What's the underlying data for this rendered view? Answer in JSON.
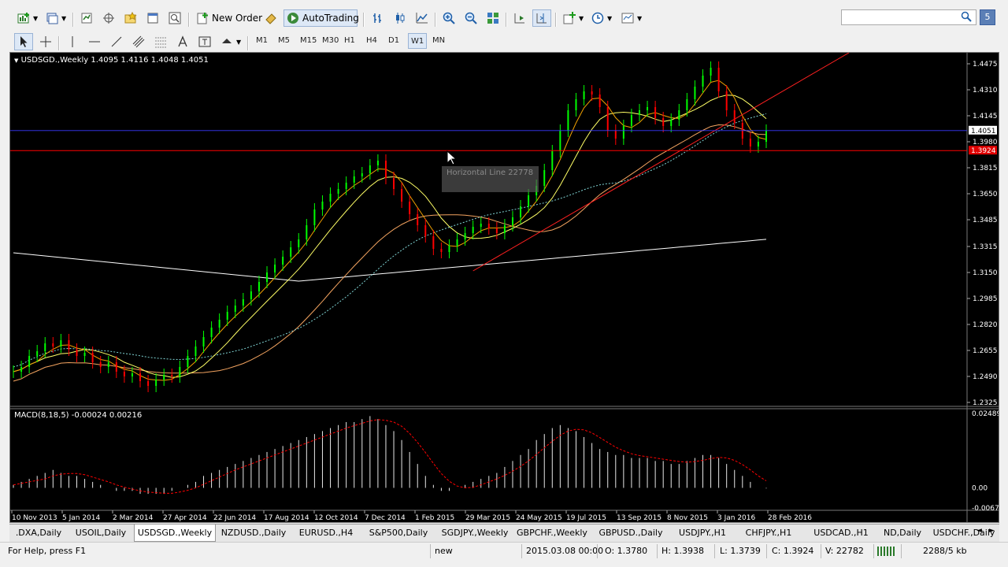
{
  "toolbar1": {
    "new_order_label": "New Order",
    "autotrading_label": "AutoTrading",
    "search_placeholder": ""
  },
  "timeframes": [
    "M1",
    "M5",
    "M15",
    "M30",
    "H1",
    "H4",
    "D1",
    "W1",
    "MN"
  ],
  "active_timeframe": "W1",
  "chart": {
    "header": "USDSGD.,Weekly  1.4095 1.4116 1.4048 1.4051",
    "current_price": "1.4051",
    "hline_price": "1.3924",
    "price_ticks": [
      "1.4475",
      "1.4310",
      "1.4145",
      "1.3980",
      "1.3815",
      "1.3650",
      "1.3485",
      "1.3315",
      "1.3150",
      "1.2985",
      "1.2820",
      "1.2655",
      "1.2490",
      "1.2325"
    ],
    "date_ticks": [
      "10 Nov 2013",
      "5 Jan 2014",
      "2 Mar 2014",
      "27 Apr 2014",
      "22 Jun 2014",
      "17 Aug 2014",
      "12 Oct 2014",
      "7 Dec 2014",
      "1 Feb 2015",
      "29 Mar 2015",
      "24 May 2015",
      "19 Jul 2015",
      "13 Sep 2015",
      "8 Nov 2015",
      "3 Jan 2016",
      "28 Feb 2016"
    ],
    "tooltip": "Horizontal Line 22778",
    "macd_label": "MACD(8,18,5) -0.00024 0.00216",
    "macd_ticks": [
      "0.02489",
      "0.00",
      "-0.00671"
    ]
  },
  "chart_data": {
    "type": "candlestick",
    "symbol": "USDSGD.",
    "period": "Weekly",
    "price_range": [
      1.2325,
      1.4475
    ],
    "ohlc_last": {
      "open": 1.4095,
      "high": 1.4116,
      "low": 1.4048,
      "close": 1.4051
    },
    "close_series": [
      1.252,
      1.255,
      1.262,
      1.265,
      1.27,
      1.268,
      1.272,
      1.266,
      1.262,
      1.264,
      1.258,
      1.255,
      1.258,
      1.252,
      1.249,
      1.251,
      1.246,
      1.243,
      1.247,
      1.25,
      1.249,
      1.255,
      1.262,
      1.268,
      1.274,
      1.28,
      1.285,
      1.29,
      1.294,
      1.298,
      1.303,
      1.309,
      1.315,
      1.32,
      1.325,
      1.331,
      1.336,
      1.345,
      1.355,
      1.36,
      1.365,
      1.368,
      1.372,
      1.376,
      1.378,
      1.383,
      1.386,
      1.375,
      1.368,
      1.36,
      1.352,
      1.345,
      1.338,
      1.33,
      1.328,
      1.332,
      1.336,
      1.34,
      1.344,
      1.346,
      1.343,
      1.34,
      1.345,
      1.35,
      1.357,
      1.364,
      1.37,
      1.38,
      1.392,
      1.405,
      1.418,
      1.425,
      1.43,
      1.428,
      1.42,
      1.405,
      1.4,
      1.408,
      1.415,
      1.418,
      1.42,
      1.413,
      1.408,
      1.412,
      1.418,
      1.425,
      1.433,
      1.44,
      1.445,
      1.43,
      1.418,
      1.41,
      1.4,
      1.395,
      1.398,
      1.405
    ],
    "macd_range": [
      -0.00671,
      0.02489
    ],
    "macd": {
      "main": -0.00024,
      "signal": 0.00216
    },
    "macd_hist": [
      0.001,
      0.002,
      0.003,
      0.004,
      0.005,
      0.006,
      0.005,
      0.004,
      0.004,
      0.003,
      0.002,
      0.001,
      0.0,
      -0.001,
      -0.001,
      -0.001,
      -0.002,
      -0.002,
      -0.002,
      -0.002,
      -0.001,
      0.0,
      0.001,
      0.002,
      0.004,
      0.005,
      0.006,
      0.007,
      0.008,
      0.009,
      0.01,
      0.011,
      0.012,
      0.013,
      0.014,
      0.015,
      0.016,
      0.017,
      0.018,
      0.019,
      0.02,
      0.021,
      0.022,
      0.022,
      0.023,
      0.024,
      0.023,
      0.021,
      0.019,
      0.016,
      0.012,
      0.008,
      0.004,
      0.001,
      -0.001,
      -0.001,
      0.0,
      0.001,
      0.002,
      0.003,
      0.004,
      0.005,
      0.007,
      0.009,
      0.011,
      0.013,
      0.016,
      0.018,
      0.02,
      0.021,
      0.02,
      0.019,
      0.017,
      0.015,
      0.013,
      0.012,
      0.011,
      0.011,
      0.01,
      0.01,
      0.01,
      0.009,
      0.009,
      0.008,
      0.008,
      0.009,
      0.01,
      0.011,
      0.011,
      0.01,
      0.008,
      0.006,
      0.004,
      0.002,
      0.0,
      -0.0002
    ],
    "colors": {
      "bull": "#00ff00",
      "bear": "#ff0000",
      "hline": "#ff0000",
      "macd_signal": "#ff0000"
    }
  },
  "tabs": [
    ".DXA,Daily",
    "USOIL,Daily",
    "USDSGD.,Weekly",
    "NZDUSD.,Daily",
    "EURUSD.,H4",
    "S&P500,Daily",
    "SGDJPY.,Weekly",
    "GBPCHF.,Weekly",
    "GBPUSD.,Daily",
    "USDJPY.,H1",
    "CHFJPY.,H1",
    "USDCAD.,H1",
    "ND,Daily",
    "USDCHF.,Daily"
  ],
  "active_tab": "USDSGD.,Weekly",
  "status": {
    "help": "For Help, press F1",
    "profile": "new",
    "datetime": "2015.03.08 00:00",
    "open": "O: 1.3780",
    "high": "H: 1.3938",
    "low": "L: 1.3739",
    "close": "C: 1.3924",
    "volume": "V: 22782",
    "traffic": "2288/5 kb"
  }
}
